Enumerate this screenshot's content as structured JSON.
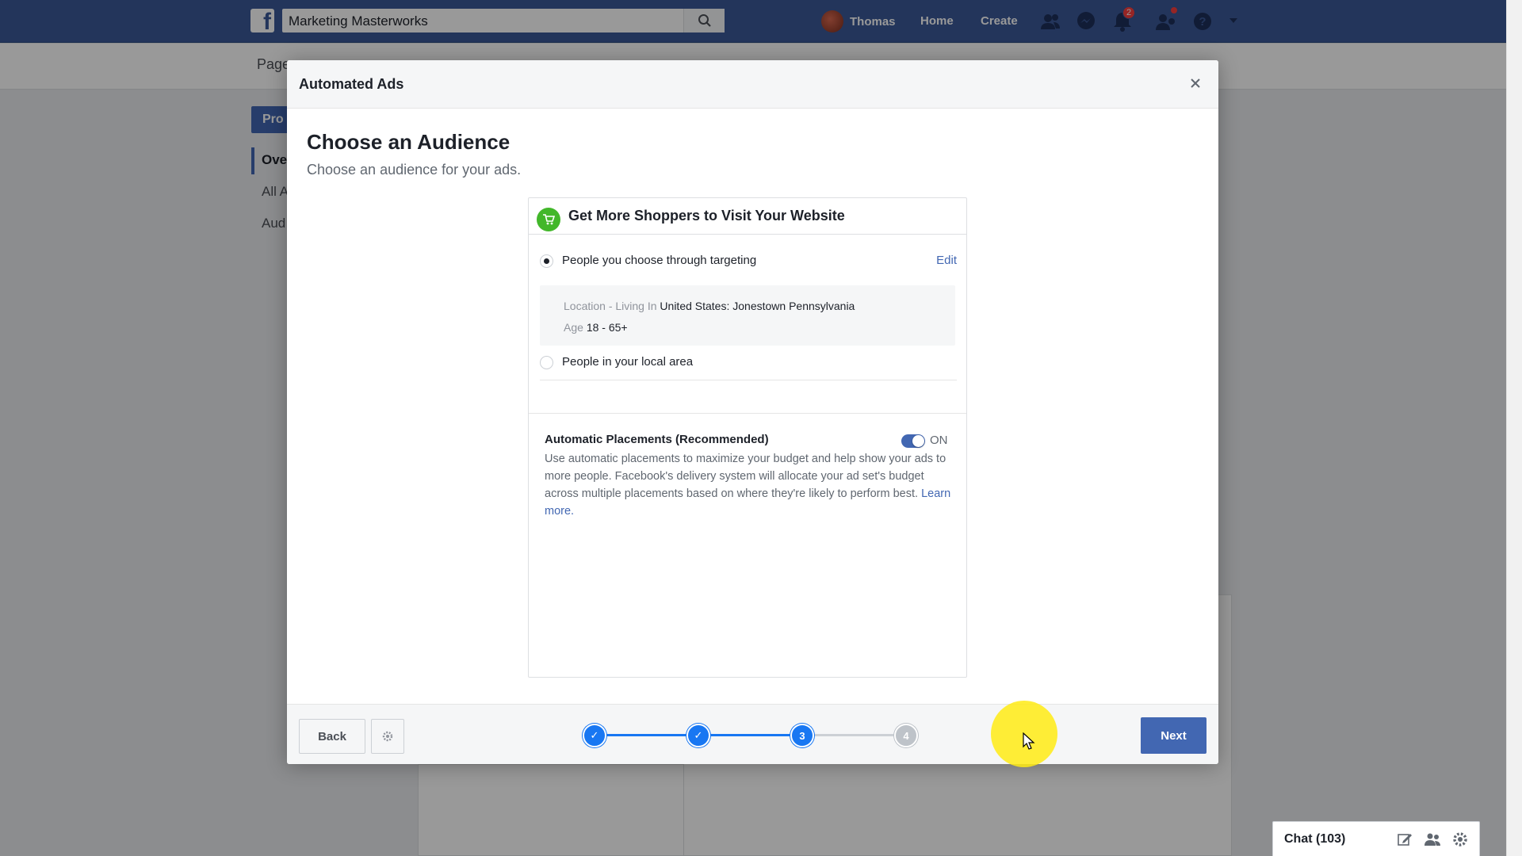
{
  "topbar": {
    "search_value": "Marketing Masterworks",
    "user_name": "Thomas",
    "home_label": "Home",
    "create_label": "Create",
    "notifications_count": "2"
  },
  "page_bg": {
    "subnav_text": "Page",
    "promote_label": "Pro",
    "left_items": [
      "Ove",
      "All A",
      "Aud"
    ]
  },
  "modal": {
    "title": "Automated Ads",
    "heading": "Choose an Audience",
    "subheading": "Choose an audience for your ads.",
    "card": {
      "title": "Get More Shoppers to Visit Your Website",
      "option1_label": "People you choose through targeting",
      "edit_label": "Edit",
      "location_key": "Location - Living In",
      "location_value": "United States: Jonestown Pennsylvania",
      "age_key": "Age",
      "age_value": "18 - 65+",
      "option2_label": "People in your local area",
      "placements_title": "Automatic Placements (Recommended)",
      "toggle_state": "ON",
      "placements_desc": "Use automatic placements to maximize your budget and help show your ads to more people. Facebook's delivery system will allocate your ad set's budget across multiple placements based on where they're likely to perform best.",
      "learn_more": "Learn more."
    },
    "footer": {
      "back_label": "Back",
      "next_label": "Next",
      "steps": [
        {
          "state": "done",
          "label": "✓"
        },
        {
          "state": "done",
          "label": "✓"
        },
        {
          "state": "current",
          "label": "3"
        },
        {
          "state": "todo",
          "label": "4"
        }
      ]
    }
  },
  "chat": {
    "label": "Chat (103)"
  },
  "colors": {
    "brand": "#3b5998",
    "accent": "#4267b2",
    "step_active": "#1877f2"
  }
}
